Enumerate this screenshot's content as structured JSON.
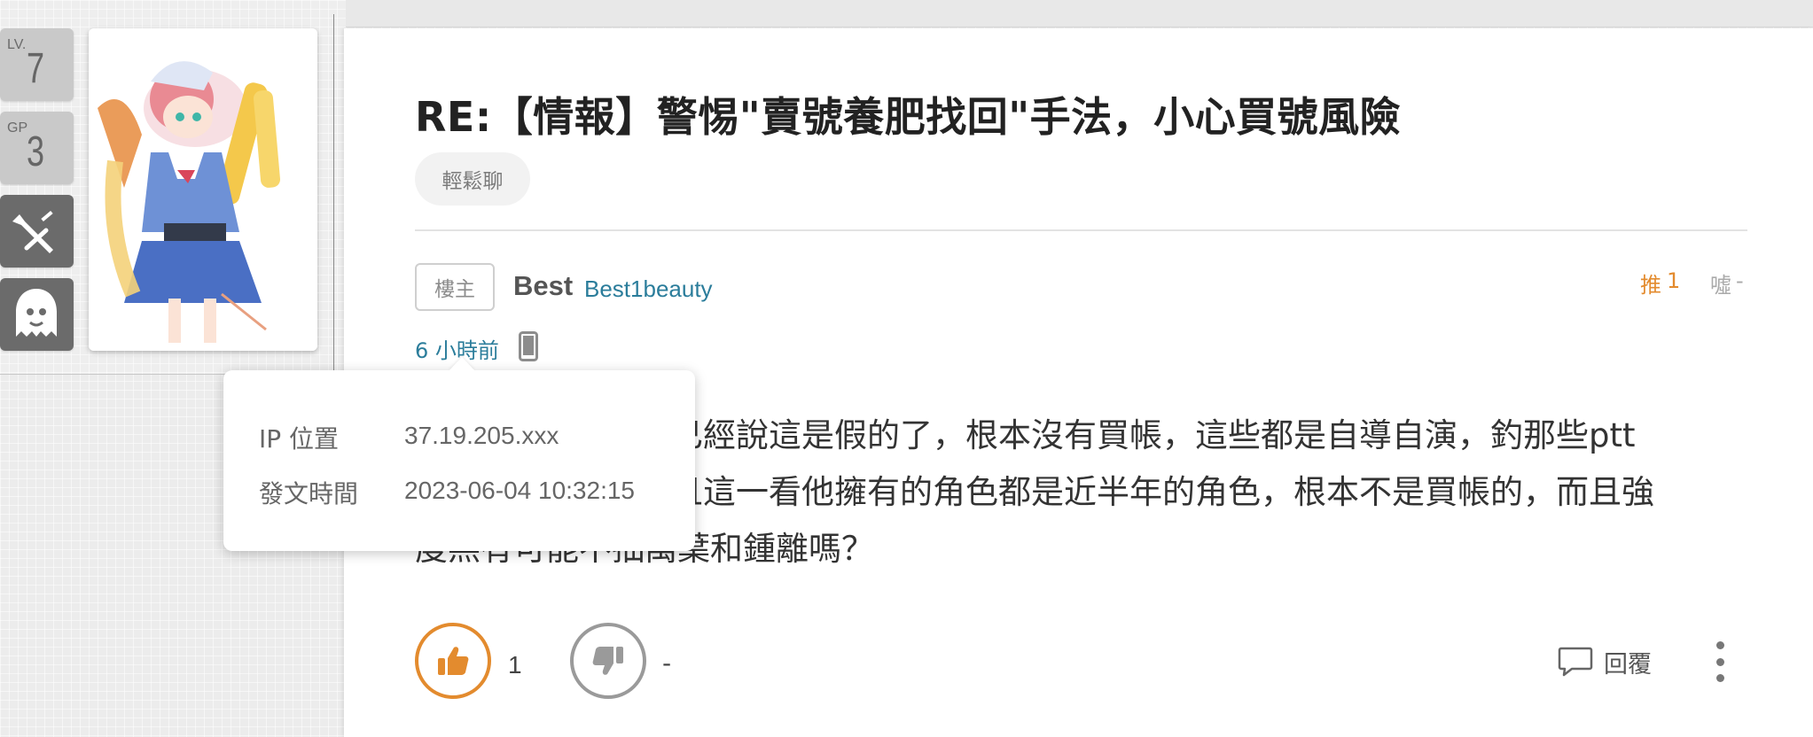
{
  "post": {
    "title": "RE:【情報】警惕\"賣號養肥找回\"手法，小心買號風險",
    "category_tag": "輕鬆聊"
  },
  "user_badges": {
    "level_prefix": "LV.",
    "level_value": "7",
    "gp_prefix": "GP",
    "gp_value": "3",
    "career_icon": "sword-icon",
    "race_icon": "ghost-icon"
  },
  "author": {
    "role_tag": "樓主",
    "name": "Best",
    "id": "Best1beauty"
  },
  "votes": {
    "push_label": "推",
    "push_count": "1",
    "boo_label": "噓",
    "boo_count": "-"
  },
  "meta": {
    "time_ago": "6 小時前",
    "device_icon": "mobile-phone-icon"
  },
  "tooltip": {
    "ip_label": "IP 位置",
    "ip_value": "37.19.205.xxx",
    "time_label": "發文時間",
    "time_value": "2023-06-04 10:32:15"
  },
  "content": {
    "line1": "已經說這是假的了，根本沒有買帳，這些都是自導自演，釣那些ptt",
    "line2": "且這一看他擁有的角色都是近半年的角色，根本不是買帳的，而且強",
    "line3": "度羔有可能不抽萬葉和鍾離嗎？"
  },
  "actions": {
    "like_count": "1",
    "dislike_count": "-",
    "reply_label": "回覆"
  },
  "colors": {
    "accent_orange": "#e38b2e",
    "link_blue": "#2b7d9b"
  }
}
